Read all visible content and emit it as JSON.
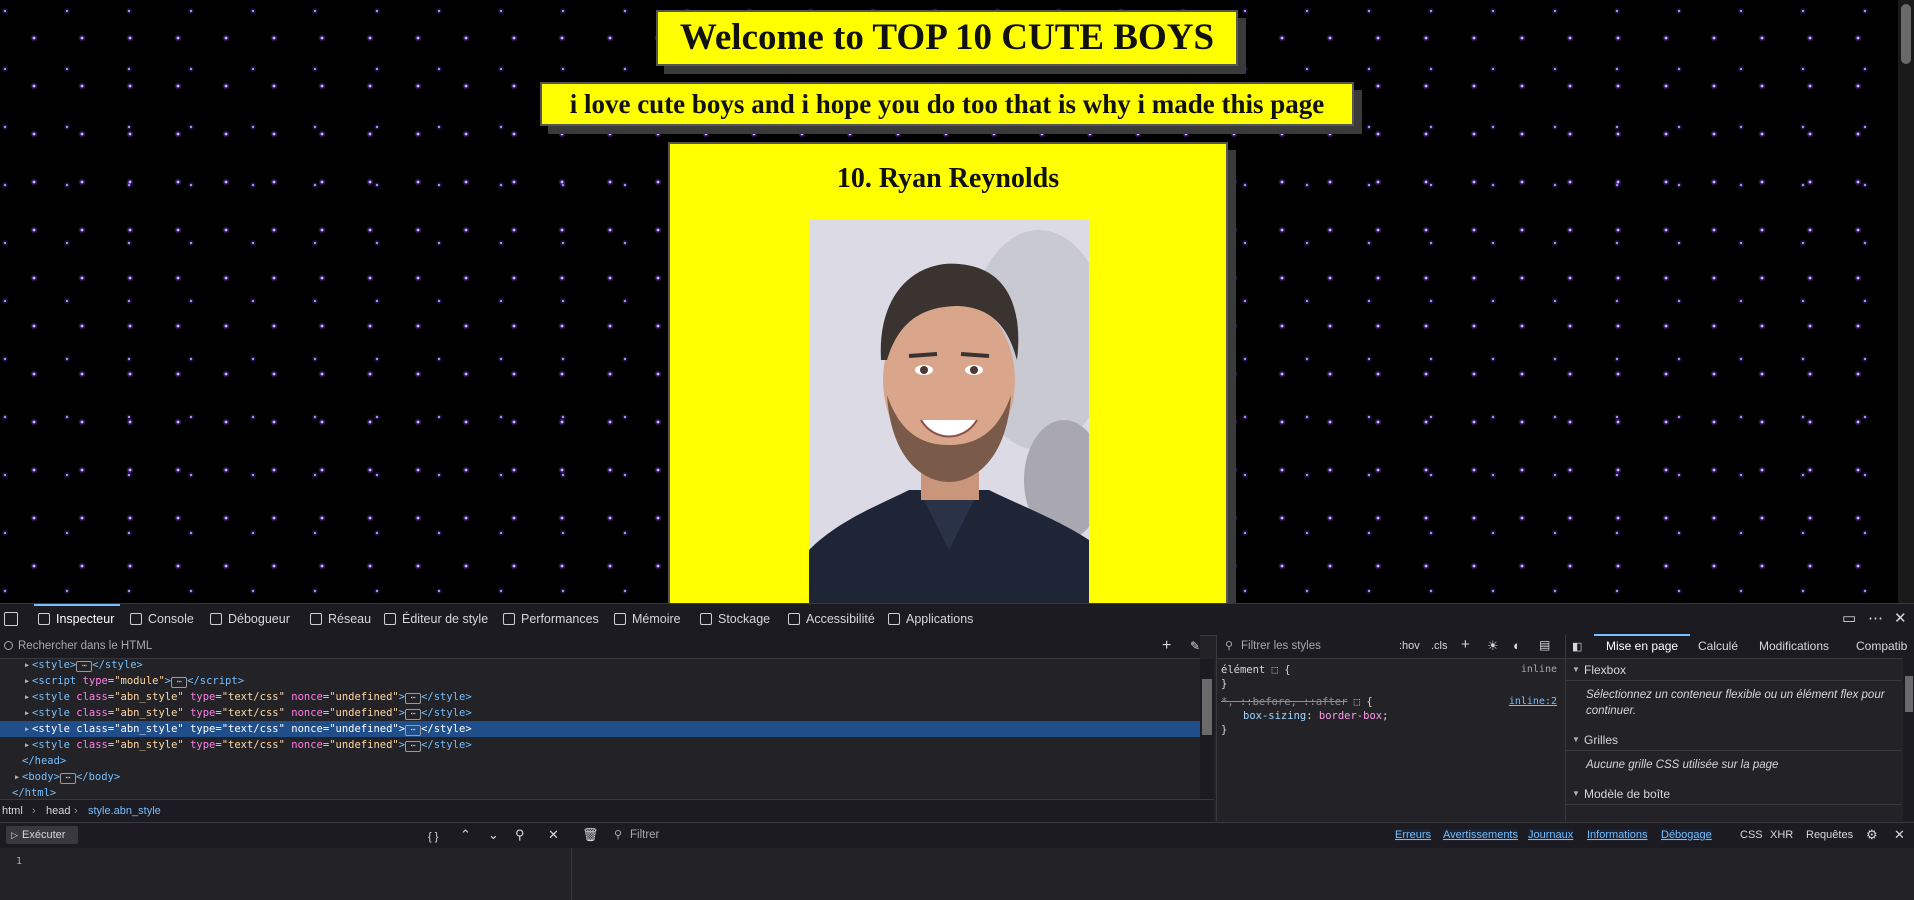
{
  "page": {
    "title": "Welcome to TOP 10 CUTE BOYS",
    "subtitle": "i love cute boys and i hope you do too that is why i made this page",
    "card_title": "10. Ryan Reynolds"
  },
  "devtools": {
    "tabs": [
      "Inspecteur",
      "Console",
      "Débogueur",
      "Réseau",
      "Éditeur de style",
      "Performances",
      "Mémoire",
      "Stockage",
      "Accessibilité",
      "Applications"
    ],
    "html_search_placeholder": "Rechercher dans le HTML",
    "markup_lines": [
      {
        "indent": 2,
        "tag": "style",
        "attrs": "",
        "collapsed": true,
        "partial": true
      },
      {
        "indent": 2,
        "tag": "script",
        "attrs": "type=\"module\"",
        "collapsed": true
      },
      {
        "indent": 2,
        "tag": "style",
        "attrs": "class=\"abn_style\" type=\"text/css\" nonce=\"undefined\"",
        "collapsed": true
      },
      {
        "indent": 2,
        "tag": "style",
        "attrs": "class=\"abn_style\" type=\"text/css\" nonce=\"undefined\"",
        "collapsed": true
      },
      {
        "indent": 2,
        "tag": "style",
        "attrs": "class=\"abn_style\" type=\"text/css\" nonce=\"undefined\"",
        "collapsed": true,
        "selected": true
      },
      {
        "indent": 2,
        "tag": "style",
        "attrs": "class=\"abn_style\" type=\"text/css\" nonce=\"undefined\"",
        "collapsed": true
      },
      {
        "indent": 2,
        "close": "head"
      },
      {
        "indent": 1,
        "tag": "body",
        "attrs": "",
        "collapsed": true
      },
      {
        "indent": 1,
        "close": "html"
      }
    ],
    "breadcrumbs": [
      "html",
      "head",
      "style.abn_style"
    ],
    "rules_filter_placeholder": "Filtrer les styles",
    "rules_tools": [
      ":hov",
      ".cls"
    ],
    "rules": {
      "element_selector": "élément",
      "element_source": "inline",
      "rule2_selector": "*, ::before, ::after",
      "rule2_source": "inline:2",
      "rule2_prop": "box-sizing",
      "rule2_value": "border-box"
    },
    "layout_tabs": [
      "Mise en page",
      "Calculé",
      "Modifications",
      "Compatib"
    ],
    "layout_sections": {
      "flexbox": "Flexbox",
      "flexbox_note": "Sélectionnez un conteneur flexible ou un élément flex pour continuer.",
      "grids": "Grilles",
      "grids_note": "Aucune grille CSS utilisée sur la page",
      "boxmodel": "Modèle de boîte"
    },
    "console": {
      "run_label": "Exécuter",
      "filter_placeholder": "Filtrer",
      "filters": [
        "Erreurs",
        "Avertissements",
        "Journaux",
        "Informations",
        "Débogage"
      ],
      "extra_filters": [
        "CSS",
        "XHR",
        "Requêtes"
      ],
      "line_number": "1"
    }
  },
  "colors": {
    "accent": "#75bfff",
    "highlight": "#ffff00",
    "selection": "#204e8a"
  }
}
